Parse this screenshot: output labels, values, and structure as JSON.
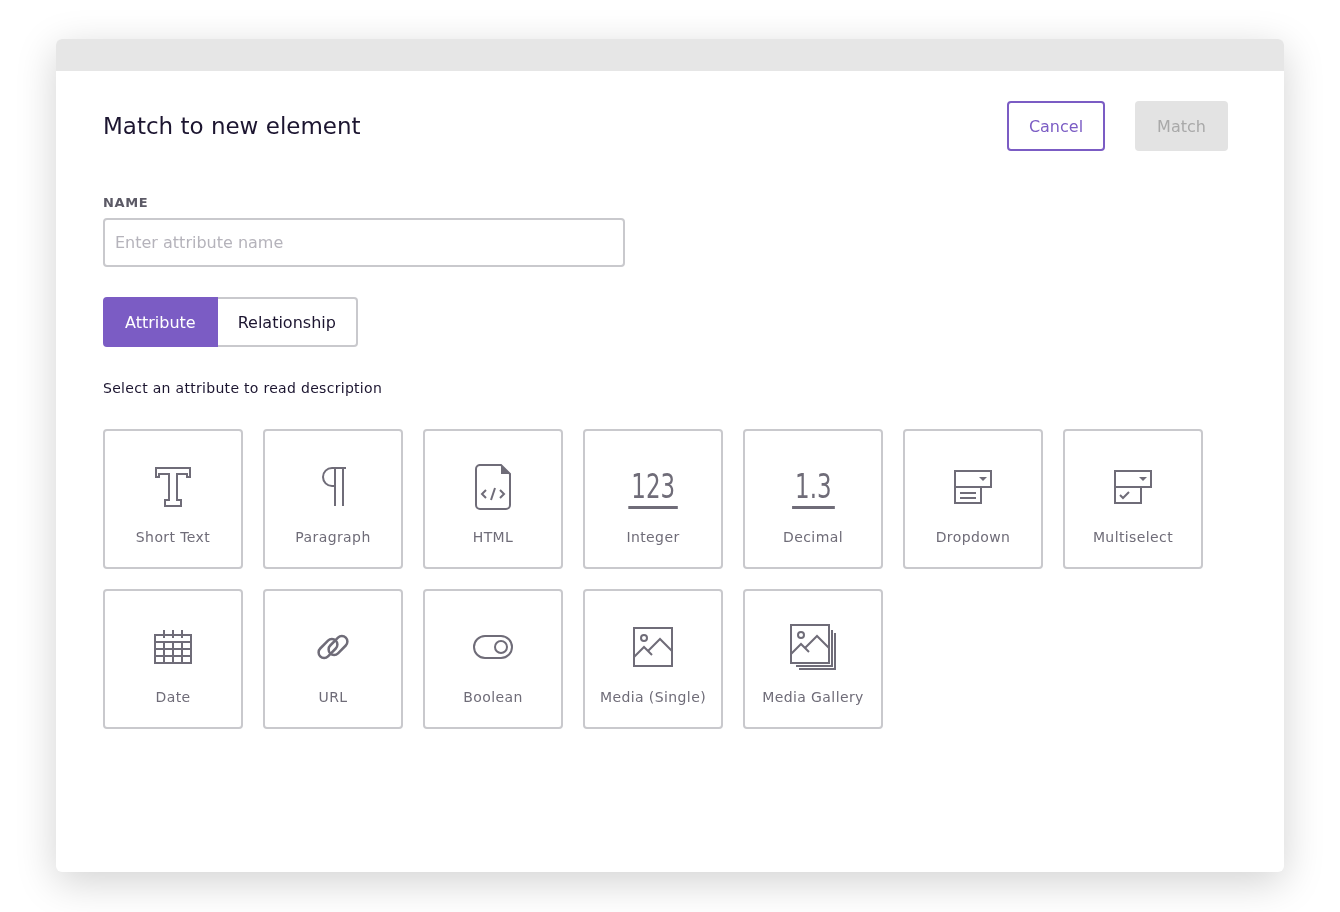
{
  "dialog": {
    "title": "Match to new element",
    "buttons": [
      {
        "label": "Cancel",
        "kind": "secondary",
        "disabled": false
      },
      {
        "label": "Match",
        "kind": "primary",
        "disabled": true
      }
    ]
  },
  "name_field": {
    "label": "NAME",
    "placeholder": "Enter attribute name"
  },
  "tabs": [
    {
      "label": "Attribute",
      "selected": true
    },
    {
      "label": "Relationship",
      "selected": false
    }
  ],
  "hint": "Select an attribute to read description",
  "types": [
    {
      "label": "Short Text",
      "kind": "text"
    },
    {
      "label": "Paragraph",
      "kind": "paragraph"
    },
    {
      "label": "HTML",
      "kind": "html"
    },
    {
      "label": "Integer",
      "kind": "number",
      "glyph": "123"
    },
    {
      "label": "Decimal",
      "kind": "number",
      "glyph": "1.3"
    },
    {
      "label": "Dropdown",
      "kind": "dropdown"
    },
    {
      "label": "Multiselect",
      "kind": "multiselect"
    },
    {
      "label": "Date",
      "kind": "date"
    },
    {
      "label": "URL",
      "kind": "url"
    },
    {
      "label": "Boolean",
      "kind": "boolean"
    },
    {
      "label": "Media (Single)",
      "kind": "media"
    },
    {
      "label": "Media Gallery",
      "kind": "gallery"
    }
  ]
}
